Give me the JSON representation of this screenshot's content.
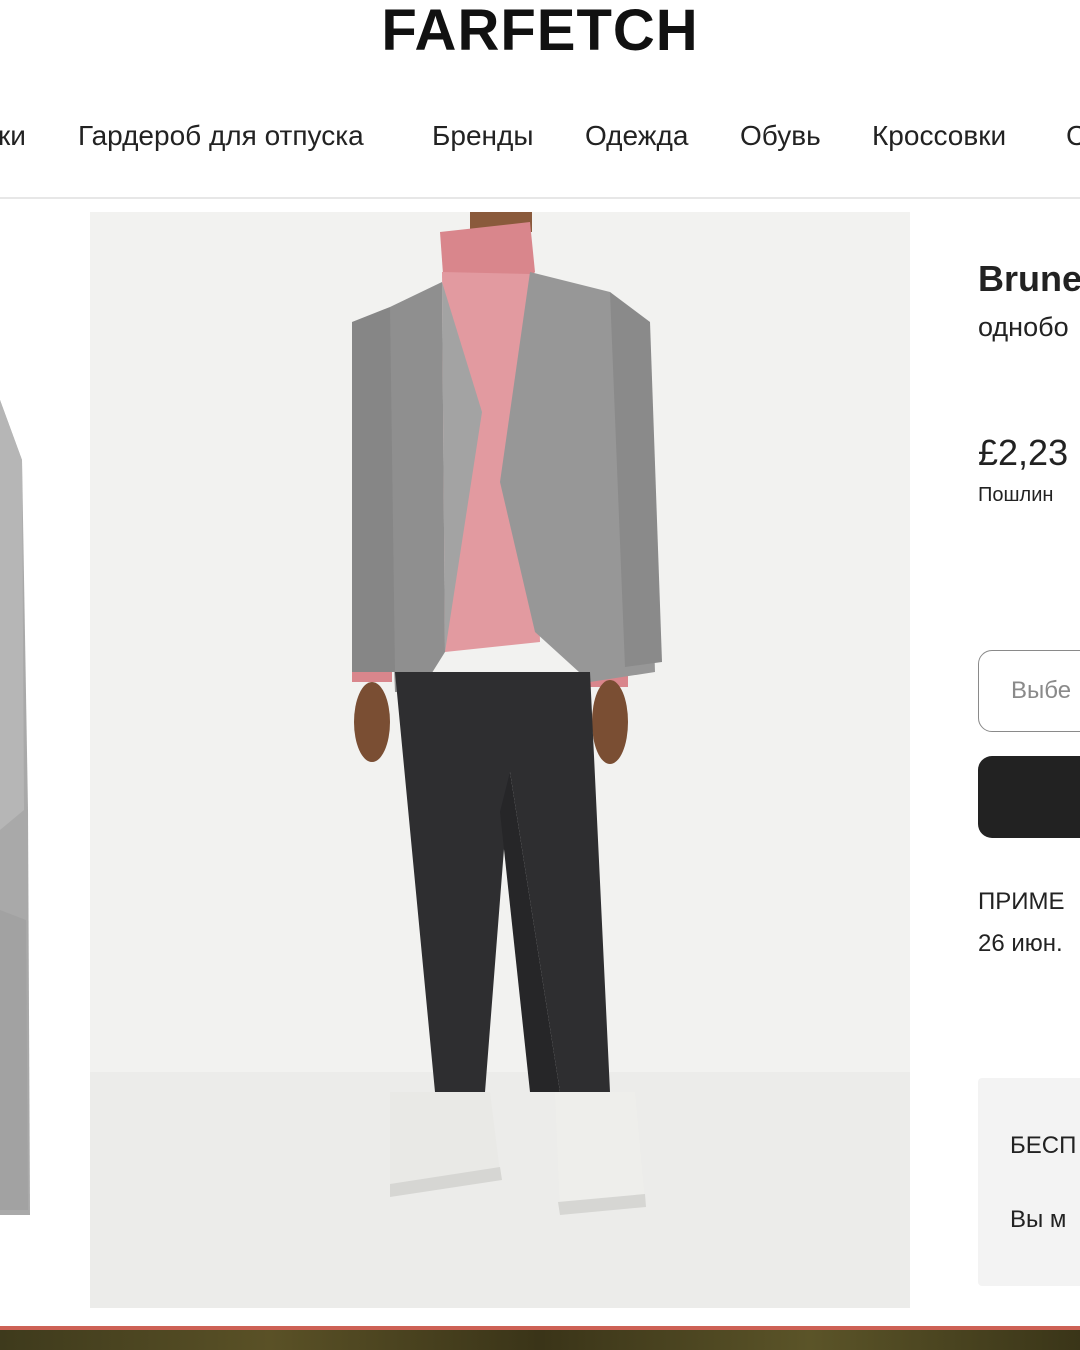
{
  "header": {
    "logo": "FARFETCH"
  },
  "nav": {
    "items": [
      {
        "label": "ки"
      },
      {
        "label": "Гардероб для отпуска"
      },
      {
        "label": "Бренды"
      },
      {
        "label": "Одежда"
      },
      {
        "label": "Обувь"
      },
      {
        "label": "Кроссовки"
      },
      {
        "label": "С"
      }
    ]
  },
  "product": {
    "brand": "Brune",
    "subtitle": "однобо",
    "price": "£2,23",
    "duties": "Пошлин",
    "size_select_placeholder": "Выбе",
    "delivery_title": "ПРИМЕ",
    "delivery_date": "26 июн.",
    "promo_title": "БЕСП",
    "promo_text": "Вы м"
  },
  "colors": {
    "accent_button": "#222222",
    "image_background": "#f3f3f1",
    "promo_background": "#f3f3f3"
  }
}
